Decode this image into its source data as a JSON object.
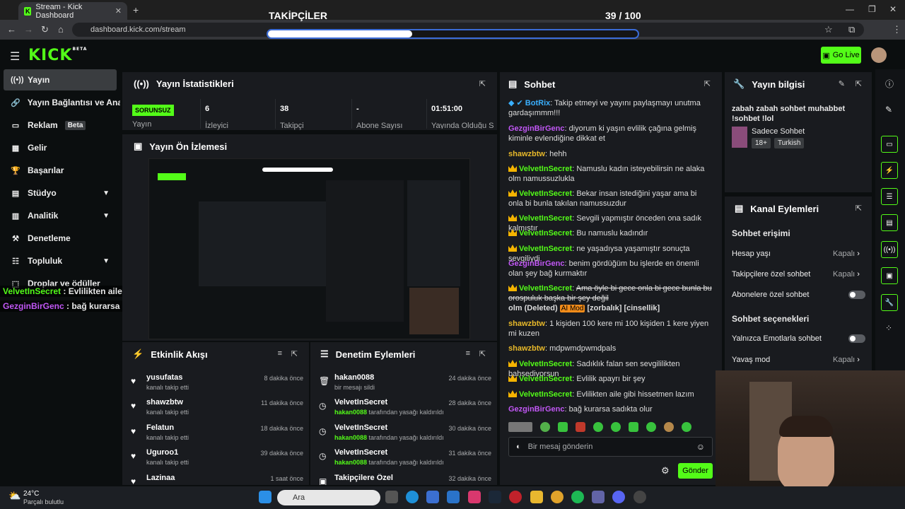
{
  "browser": {
    "tab_title": "Stream - Kick Dashboard",
    "url": "dashboard.kick.com/stream"
  },
  "overlay": {
    "title": "TAKİPÇİLER",
    "count_text": "39 / 100",
    "progress": 0.39
  },
  "header": {
    "logo": "KICK",
    "logo_sup": "BETA",
    "go_live": "Go Live"
  },
  "sidebar": {
    "items": [
      {
        "label": "Yayın"
      },
      {
        "label": "Yayın Bağlantısı ve Anahtar"
      },
      {
        "label": "Reklam",
        "badge": "Beta"
      },
      {
        "label": "Gelir"
      },
      {
        "label": "Başarılar"
      },
      {
        "label": "Stüdyo"
      },
      {
        "label": "Analitik"
      },
      {
        "label": "Denetleme"
      },
      {
        "label": "Topluluk"
      },
      {
        "label": "Droplar ve ödüller"
      }
    ]
  },
  "stream_overlay_chat": [
    {
      "user": "VelvetInSecret",
      "text": " : Evlilikten aile gibi hissetmen lazım"
    },
    {
      "user": "GezginBirGenc",
      "text": " : bağ kurarsa sadıkta olur"
    }
  ],
  "stats": {
    "title": "Yayın İstatistikleri",
    "status_badge": "SORUNSUZ",
    "status_label": "Yayın",
    "columns": [
      {
        "value": "6",
        "label": "İzleyici"
      },
      {
        "value": "38",
        "label": "Takipçi"
      },
      {
        "value": "-",
        "label": "Abone Sayısı"
      },
      {
        "value": "01:51:00",
        "label": "Yayında Olduğu Süre"
      }
    ]
  },
  "preview": {
    "title": "Yayın Ön İzlemesi"
  },
  "activity": {
    "title": "Etkinlik Akışı",
    "items": [
      {
        "name": "yusufatas",
        "sub": "kanalı takip etti",
        "time": "8 dakika önce"
      },
      {
        "name": "shawzbtw",
        "sub": "kanalı takip etti",
        "time": "11 dakika önce"
      },
      {
        "name": "Felatun",
        "sub": "kanalı takip etti",
        "time": "18 dakika önce"
      },
      {
        "name": "Uguroo1",
        "sub": "kanalı takip etti",
        "time": "39 dakika önce"
      },
      {
        "name": "Lazinaa",
        "sub": "",
        "time": "1 saat önce"
      }
    ]
  },
  "moderation": {
    "title": "Denetim Eylemleri",
    "items": [
      {
        "name": "hakan0088",
        "actor": "",
        "sub": "bir mesajı sildi",
        "time": "24 dakika önce"
      },
      {
        "name": "VelvetInSecret",
        "actor": "hakan0088",
        "sub": " tarafından yasağı kaldırıldı",
        "time": "28 dakika önce"
      },
      {
        "name": "VelvetInSecret",
        "actor": "hakan0088",
        "sub": " tarafından yasağı kaldırıldı",
        "time": "30 dakika önce"
      },
      {
        "name": "VelvetInSecret",
        "actor": "hakan0088",
        "sub": " tarafından yasağı kaldırıldı",
        "time": "31 dakika önce"
      },
      {
        "name": "Takipçilere Özel",
        "actor": "",
        "sub": "",
        "time": "32 dakika önce"
      }
    ]
  },
  "chat": {
    "title": "Sohbet",
    "input_placeholder": "Bir mesaj gönderin",
    "send_label": "Gönder",
    "messages": [
      {
        "user": "BotRix",
        "color": "blue",
        "text": "Takip etmeyi ve yayını paylaşmayı unutma gardaşımmm!!!"
      },
      {
        "user": "GezginBirGenc",
        "color": "purple",
        "text": "diyorum ki yaşın evlilik çağına gelmiş kiminle evlendiğine dikkat et"
      },
      {
        "user": "shawzbtw",
        "color": "yellow",
        "text": "hehh"
      },
      {
        "user": "VelvetInSecret",
        "color": "green",
        "text": "Namuslu kadın isteyebilirsin ne alaka olm namussuzlukla"
      },
      {
        "user": "VelvetInSecret",
        "color": "green",
        "text": "Bekar insan istediğini yaşar ama bi onla bi bunla takılan namussuzdur"
      },
      {
        "user": "VelvetInSecret",
        "color": "green",
        "text": "Sevgili yapmıştır önceden ona sadık kalmıştır"
      },
      {
        "user": "VelvetInSecret",
        "color": "green",
        "text": "Bu namuslu kadındır"
      },
      {
        "user": "VelvetInSecret",
        "color": "green",
        "text": "ne yaşadıysa yaşamıştır sonuçta sevgiliydi"
      },
      {
        "user": "GezginBirGenc",
        "color": "purple",
        "text": "benim gördüğüm bu işlerde en önemli olan şey bağ kurmaktır"
      },
      {
        "user": "VelvetInSecret",
        "color": "green",
        "text": "Ama öyle bi gece onla bi gece bunla bu orospuluk başka bir şey değil"
      },
      {
        "user": "shawzbtw",
        "color": "yellow",
        "text": "1 kişiden 100 kere mi 100 kişiden 1 kere yiyen mi kuzen"
      },
      {
        "user": "shawzbtw",
        "color": "yellow",
        "text": "mdpwmdpwmdpals"
      },
      {
        "user": "VelvetInSecret",
        "color": "green",
        "text": "Sadıklık falan sen sevgililikten bahsediyorsun"
      },
      {
        "user": "VelvetInSecret",
        "color": "green",
        "text": "Evlilik apayrı bir şey"
      },
      {
        "user": "VelvetInSecret",
        "color": "green",
        "text": "Evlilikten aile gibi hissetmen lazım"
      },
      {
        "user": "GezginBirGenc",
        "color": "purple",
        "text": "bağ kurarsa sadıkta olur"
      }
    ],
    "deleted_tail": "olm (Deleted)",
    "ai_mod": "AI Mod",
    "flags": "[zorbalık] [cinsellik]"
  },
  "stream_info": {
    "title": "Yayın bilgisi",
    "stream_title": "zabah zabah sohbet muhabbet !sohbet !lol",
    "category": "Sadece Sohbet",
    "tags": [
      "18+",
      "Turkish"
    ]
  },
  "channel_actions": {
    "title": "Kanal Eylemleri",
    "chat_access": "Sohbet erişimi",
    "rows": [
      {
        "label": "Hesap yaşı",
        "value": "Kapalı"
      },
      {
        "label": "Takipçilere özel sohbet",
        "value": "Kapalı"
      },
      {
        "label": "Abonelere özel sohbet",
        "value": ""
      }
    ],
    "chat_options": "Sohbet seçenekleri",
    "rows2": [
      {
        "label": "Yalnızca Emotlarla sohbet",
        "value": ""
      },
      {
        "label": "Yavaş mod",
        "value": "Kapalı"
      }
    ]
  },
  "taskbar": {
    "weather_temp": "24°C",
    "weather_desc": "Parçalı bulutlu",
    "search_placeholder": "Ara"
  }
}
